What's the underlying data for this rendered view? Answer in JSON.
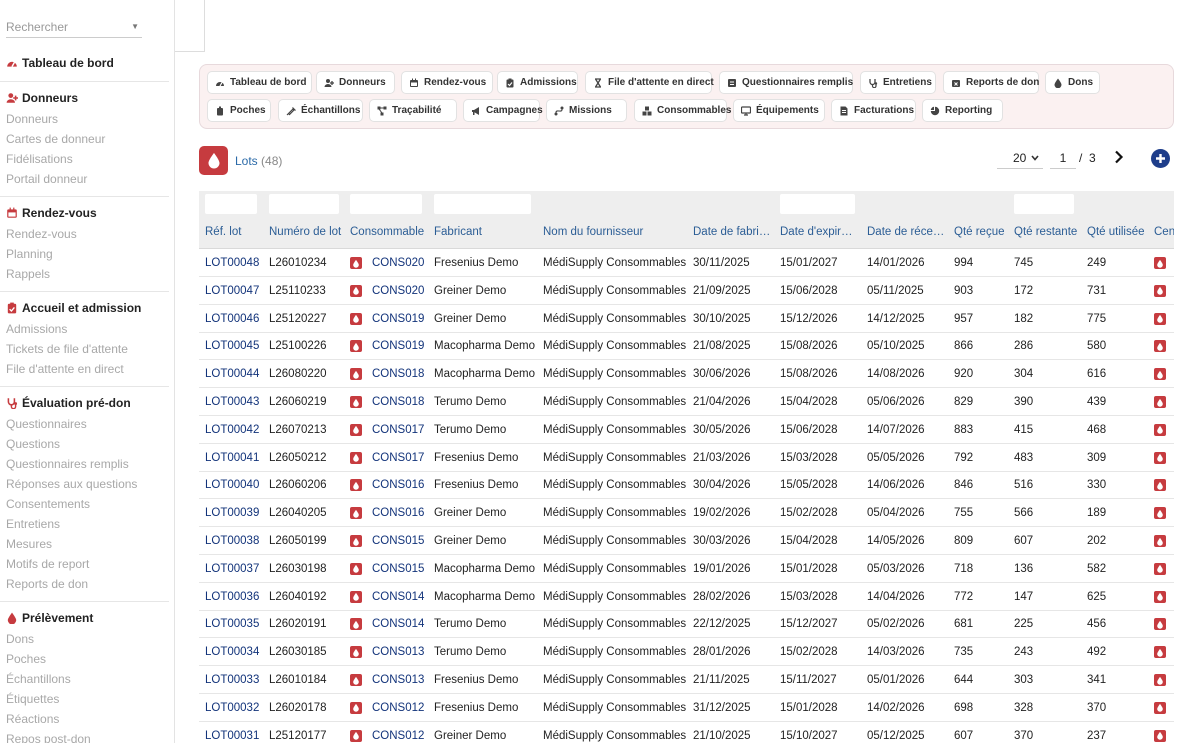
{
  "search": {
    "placeholder": "Rechercher"
  },
  "sidebar": {
    "dashboard": "Tableau de bord",
    "sections": [
      {
        "title": "Donneurs",
        "icon": "user-plus-icon",
        "items": [
          "Donneurs",
          "Cartes de donneur",
          "Fidélisations",
          "Portail donneur"
        ]
      },
      {
        "title": "Rendez-vous",
        "icon": "calendar-icon",
        "items": [
          "Rendez-vous",
          "Planning",
          "Rappels"
        ]
      },
      {
        "title": "Accueil et admission",
        "icon": "clipboard-icon",
        "items": [
          "Admissions",
          "Tickets de file d'attente",
          "File d'attente en direct"
        ]
      },
      {
        "title": "Évaluation pré-don",
        "icon": "stethoscope-icon",
        "items": [
          "Questionnaires",
          "Questions",
          "Questionnaires remplis",
          "Réponses aux questions",
          "Consentements",
          "Entretiens",
          "Mesures",
          "Motifs de report",
          "Reports de don"
        ]
      },
      {
        "title": "Prélèvement",
        "icon": "drop-icon",
        "items": [
          "Dons",
          "Poches",
          "Échantillons",
          "Étiquettes",
          "Réactions",
          "Repos post-don"
        ]
      }
    ]
  },
  "nav": {
    "row1": [
      {
        "label": "Tableau de bord",
        "icon": "gauge-icon"
      },
      {
        "label": "Donneurs",
        "icon": "user-plus-icon"
      },
      {
        "label": "Rendez-vous",
        "icon": "calendar-icon"
      },
      {
        "label": "Admissions",
        "icon": "clipboard-icon"
      },
      {
        "label": "File d'attente en direct",
        "icon": "hourglass-icon"
      },
      {
        "label": "Questionnaires remplis",
        "icon": "form-icon"
      },
      {
        "label": "Entretiens",
        "icon": "stethoscope-icon"
      },
      {
        "label": "Reports de don",
        "icon": "calendar-x-icon"
      },
      {
        "label": "Dons",
        "icon": "drop-icon"
      }
    ],
    "row2": [
      {
        "label": "Poches",
        "icon": "bag-icon"
      },
      {
        "label": "Échantillons",
        "icon": "syringe-icon"
      },
      {
        "label": "Traçabilité",
        "icon": "network-icon"
      },
      {
        "label": "Campagnes",
        "icon": "megaphone-icon"
      },
      {
        "label": "Missions",
        "icon": "route-icon"
      },
      {
        "label": "Consommables",
        "icon": "boxes-icon"
      },
      {
        "label": "Équipements",
        "icon": "monitor-icon"
      },
      {
        "label": "Facturations",
        "icon": "invoice-icon"
      },
      {
        "label": "Reporting",
        "icon": "chart-pie-icon"
      }
    ]
  },
  "list": {
    "title": "Lots",
    "count": "(48)",
    "per_page": "20",
    "page": "1",
    "page_sep": "/",
    "total_pages": "3"
  },
  "columns": [
    "Réf. lot",
    "Numéro de lot",
    "Consommable",
    "Fabricant",
    "Nom du fournisseur",
    "Date de fabrication",
    "Date d'expiration",
    "Date de réception",
    "Qté reçue",
    "Qté restante",
    "Qté utilisée",
    "Centre"
  ],
  "columns_display": [
    "Réf. lot",
    "Numéro de lot",
    "Consommable",
    "Fabricant",
    "Nom du fournisseur",
    "Date de fabri…",
    "Date d'expir…",
    "Date de réce…",
    "Qté reçue",
    "Qté restante",
    "Qté utilisée",
    "Cen"
  ],
  "rows": [
    [
      "LOT00048",
      "L26010234",
      "CONS020",
      "Fresenius Demo",
      "MédiSupply Consommables",
      "30/11/2025",
      "15/01/2027",
      "14/01/2026",
      "994",
      "745",
      "249"
    ],
    [
      "LOT00047",
      "L25110233",
      "CONS020",
      "Greiner Demo",
      "MédiSupply Consommables",
      "21/09/2025",
      "15/06/2028",
      "05/11/2025",
      "903",
      "172",
      "731"
    ],
    [
      "LOT00046",
      "L25120227",
      "CONS019",
      "Greiner Demo",
      "MédiSupply Consommables",
      "30/10/2025",
      "15/12/2026",
      "14/12/2025",
      "957",
      "182",
      "775"
    ],
    [
      "LOT00045",
      "L25100226",
      "CONS019",
      "Macopharma Demo",
      "MédiSupply Consommables",
      "21/08/2025",
      "15/08/2026",
      "05/10/2025",
      "866",
      "286",
      "580"
    ],
    [
      "LOT00044",
      "L26080220",
      "CONS018",
      "Macopharma Demo",
      "MédiSupply Consommables",
      "30/06/2026",
      "15/08/2026",
      "14/08/2026",
      "920",
      "304",
      "616"
    ],
    [
      "LOT00043",
      "L26060219",
      "CONS018",
      "Terumo Demo",
      "MédiSupply Consommables",
      "21/04/2026",
      "15/04/2028",
      "05/06/2026",
      "829",
      "390",
      "439"
    ],
    [
      "LOT00042",
      "L26070213",
      "CONS017",
      "Terumo Demo",
      "MédiSupply Consommables",
      "30/05/2026",
      "15/06/2028",
      "14/07/2026",
      "883",
      "415",
      "468"
    ],
    [
      "LOT00041",
      "L26050212",
      "CONS017",
      "Fresenius Demo",
      "MédiSupply Consommables",
      "21/03/2026",
      "15/03/2028",
      "05/05/2026",
      "792",
      "483",
      "309"
    ],
    [
      "LOT00040",
      "L26060206",
      "CONS016",
      "Fresenius Demo",
      "MédiSupply Consommables",
      "30/04/2026",
      "15/05/2028",
      "14/06/2026",
      "846",
      "516",
      "330"
    ],
    [
      "LOT00039",
      "L26040205",
      "CONS016",
      "Greiner Demo",
      "MédiSupply Consommables",
      "19/02/2026",
      "15/02/2028",
      "05/04/2026",
      "755",
      "566",
      "189"
    ],
    [
      "LOT00038",
      "L26050199",
      "CONS015",
      "Greiner Demo",
      "MédiSupply Consommables",
      "30/03/2026",
      "15/04/2028",
      "14/05/2026",
      "809",
      "607",
      "202"
    ],
    [
      "LOT00037",
      "L26030198",
      "CONS015",
      "Macopharma Demo",
      "MédiSupply Consommables",
      "19/01/2026",
      "15/01/2028",
      "05/03/2026",
      "718",
      "136",
      "582"
    ],
    [
      "LOT00036",
      "L26040192",
      "CONS014",
      "Macopharma Demo",
      "MédiSupply Consommables",
      "28/02/2026",
      "15/03/2028",
      "14/04/2026",
      "772",
      "147",
      "625"
    ],
    [
      "LOT00035",
      "L26020191",
      "CONS014",
      "Terumo Demo",
      "MédiSupply Consommables",
      "22/12/2025",
      "15/12/2027",
      "05/02/2026",
      "681",
      "225",
      "456"
    ],
    [
      "LOT00034",
      "L26030185",
      "CONS013",
      "Terumo Demo",
      "MédiSupply Consommables",
      "28/01/2026",
      "15/02/2028",
      "14/03/2026",
      "735",
      "243",
      "492"
    ],
    [
      "LOT00033",
      "L26010184",
      "CONS013",
      "Fresenius Demo",
      "MédiSupply Consommables",
      "21/11/2025",
      "15/11/2027",
      "05/01/2026",
      "644",
      "303",
      "341"
    ],
    [
      "LOT00032",
      "L26020178",
      "CONS012",
      "Fresenius Demo",
      "MédiSupply Consommables",
      "31/12/2025",
      "15/01/2028",
      "14/02/2026",
      "698",
      "328",
      "370"
    ],
    [
      "LOT00031",
      "L25120177",
      "CONS012",
      "Greiner Demo",
      "MédiSupply Consommables",
      "21/10/2025",
      "15/10/2027",
      "05/12/2025",
      "607",
      "370",
      "237"
    ]
  ]
}
